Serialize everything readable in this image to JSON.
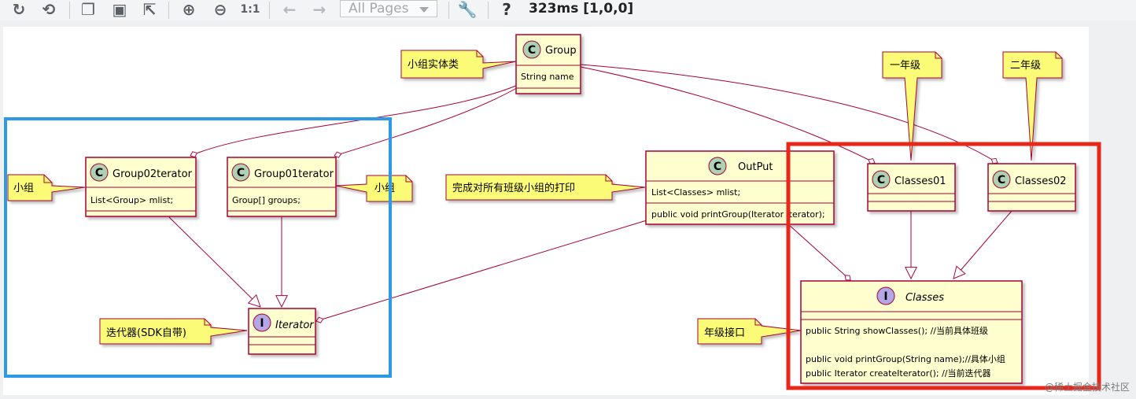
{
  "toolbar": {
    "select_value": "All Pages",
    "zoom_reset_label": "1:1",
    "help_label": "?",
    "status_text": "323ms [1,0,0]"
  },
  "diagram": {
    "classes": {
      "group": {
        "name": "Group",
        "stereotype": "C",
        "fields": [
          "String name"
        ]
      },
      "group02": {
        "name": "Group02terator",
        "stereotype": "C",
        "fields": [
          "List<Group> mlist;"
        ]
      },
      "group01": {
        "name": "Group01terator",
        "stereotype": "C",
        "fields": [
          "Group[] groups;"
        ]
      },
      "iterator": {
        "name": "Iterator",
        "stereotype": "I"
      },
      "output": {
        "name": "OutPut",
        "stereotype": "C",
        "fields": [
          "List<Classes> mlist;"
        ],
        "methods": [
          "public void printGroup(Iterator iterator);"
        ]
      },
      "classes01": {
        "name": "Classes01",
        "stereotype": "C"
      },
      "classes02": {
        "name": "Classes02",
        "stereotype": "C"
      },
      "classes": {
        "name": "Classes",
        "stereotype": "I",
        "methods": [
          "public String showClasses();  //当前具体班级",
          "public void printGroup(String name);//具体小组",
          "public Iterator createIterator(); //当前迭代器"
        ]
      }
    },
    "notes": {
      "group": "小组实体类",
      "group02": "小组",
      "group01": "小组",
      "iterator": "迭代器(SDK自带)",
      "output": "完成对所有班级小组的打印",
      "classes01": "一年级",
      "classes02": "二年级",
      "classes": "年级接口"
    },
    "watermark": "@稀土掘金技术社区",
    "colors": {
      "class_fill": "#fefece",
      "class_border": "#a80036",
      "note_fill": "#fbfb77",
      "stereo_c": "#add1b2",
      "stereo_i": "#b4a7e5",
      "highlight_blue": "#2c9ae6",
      "highlight_red": "#e8261a"
    }
  }
}
